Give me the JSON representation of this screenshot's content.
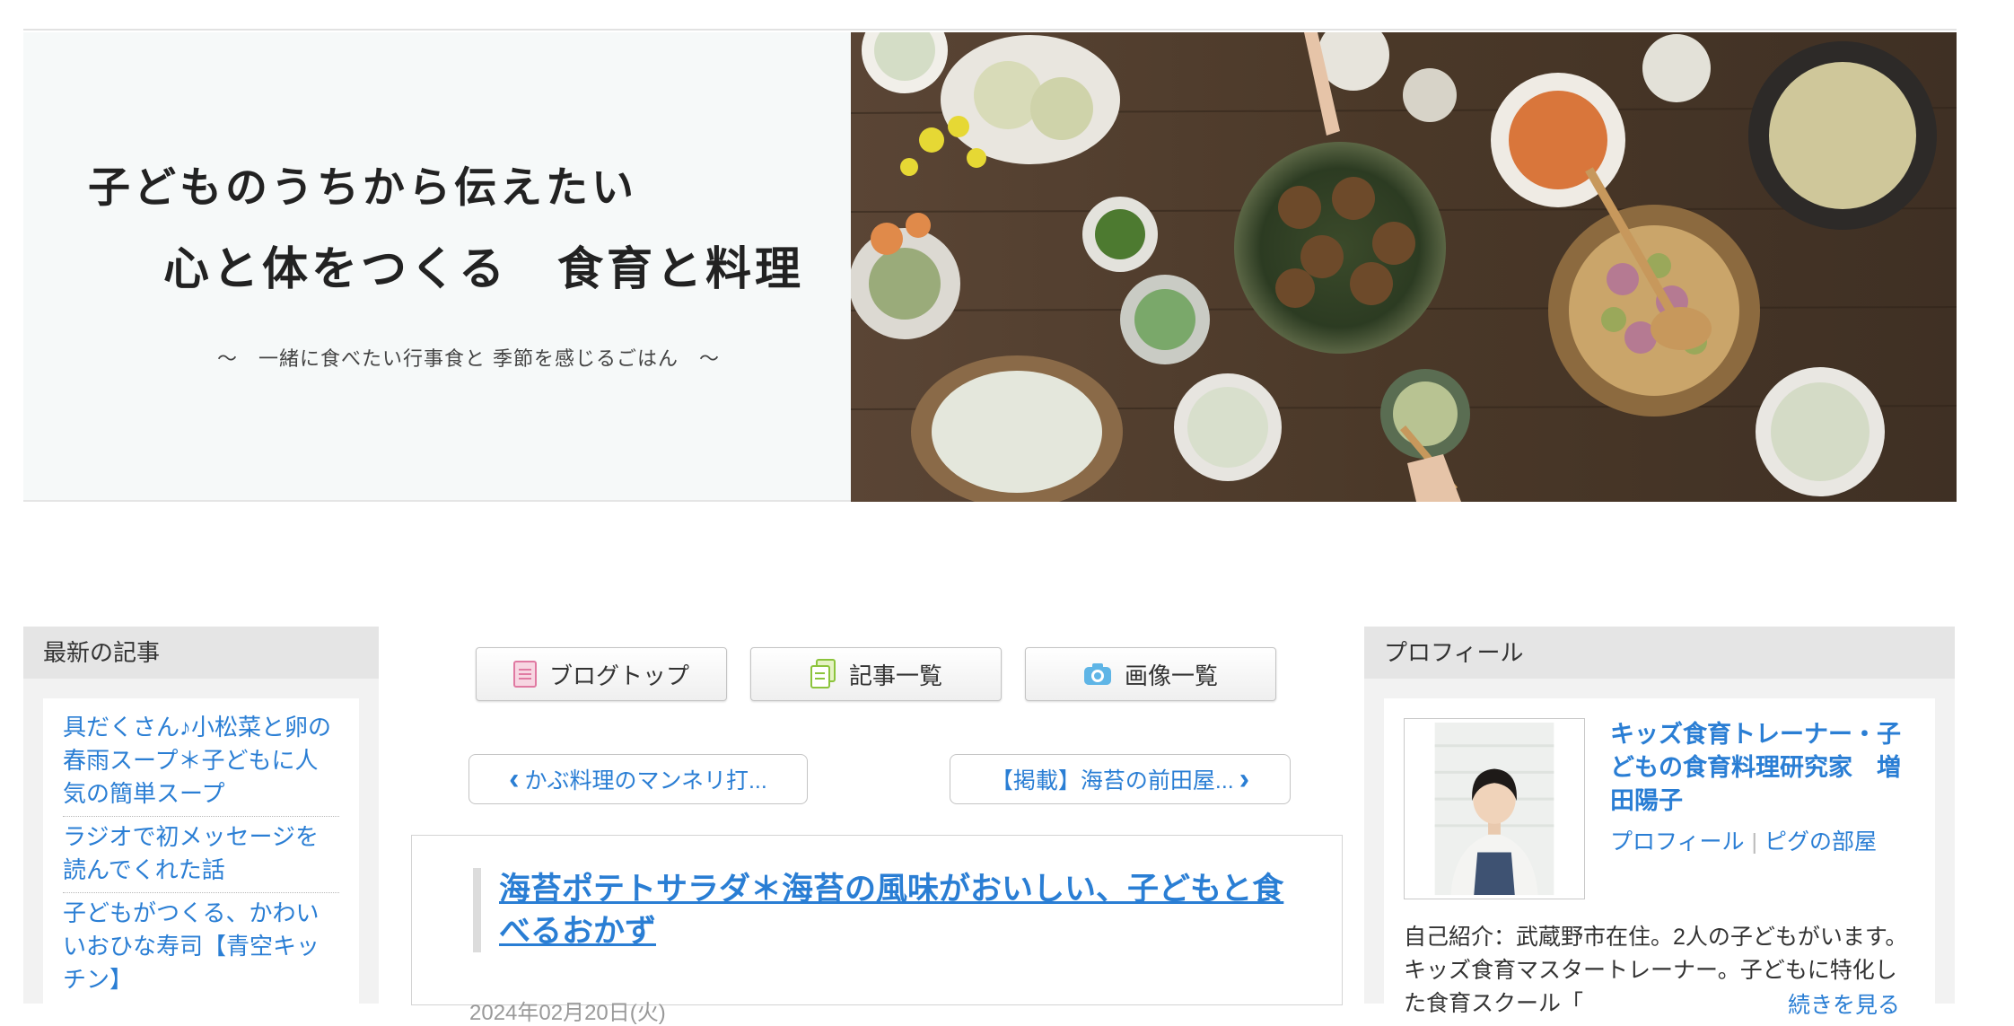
{
  "header": {
    "title_line1": "子どものうちから伝えたい",
    "title_line2": "心と体をつくる　食育と料理",
    "subtitle": "～　一緒に食べたい行事食と 季節を感じるごはん　～"
  },
  "latest": {
    "heading": "最新の記事",
    "items": [
      "具だくさん♪小松菜と卵の春雨スープ＊子どもに人気の簡単スープ",
      "ラジオで初メッセージを読んでくれた話",
      "子どもがつくる、かわいいおひな寿司【青空キッチン】"
    ]
  },
  "nav": {
    "blog_top": "ブログトップ",
    "article_list": "記事一覧",
    "image_list": "画像一覧"
  },
  "pager": {
    "prev": "かぶ料理のマンネリ打...",
    "next": "【掲載】海苔の前田屋...",
    "prev_arrow": "‹",
    "next_arrow": "›"
  },
  "article": {
    "title": "海苔ポテトサラダ＊海苔の風味がおいしい、子どもと食べるおかず",
    "date": "2024年02月20日(火)"
  },
  "profile": {
    "heading": "プロフィール",
    "name": "キッズ食育トレーナー・子どもの食育料理研究家　増田陽子",
    "link_profile": "プロフィール",
    "link_pig": "ピグの部屋",
    "intro": "自己紹介：武蔵野市在住。2人の子どもがいます。キッズ食育マスタートレーナー。子どもに特化した食育スクール「",
    "more": "続きを見る"
  },
  "colors": {
    "link": "#2a7ed4",
    "sidebar_bg": "#f2f2f2",
    "sidebar_head": "#e5e5e5"
  }
}
